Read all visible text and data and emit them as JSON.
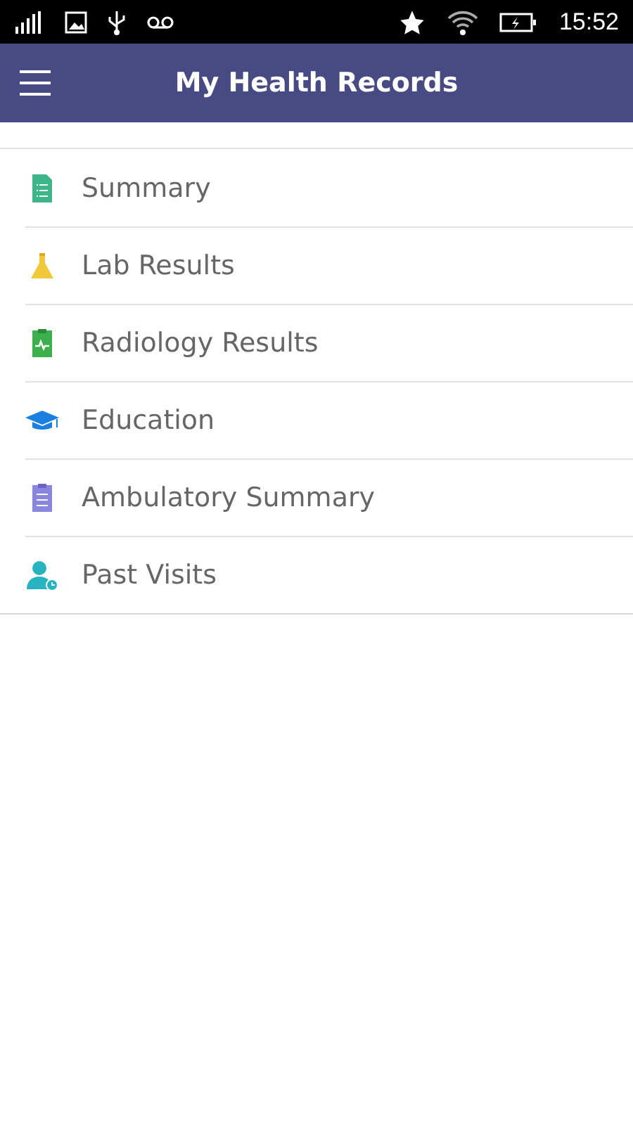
{
  "status_bar": {
    "time": "15:52"
  },
  "app_bar": {
    "title": "My Health Records"
  },
  "menu": [
    {
      "label": "Summary",
      "kind": "document"
    },
    {
      "label": "Lab Results",
      "kind": "flask"
    },
    {
      "label": "Radiology Results",
      "kind": "clipboard-pulse"
    },
    {
      "label": "Education",
      "kind": "cap"
    },
    {
      "label": "Ambulatory Summary",
      "kind": "clipboard-list"
    },
    {
      "label": "Past Visits",
      "kind": "person-clock"
    }
  ]
}
